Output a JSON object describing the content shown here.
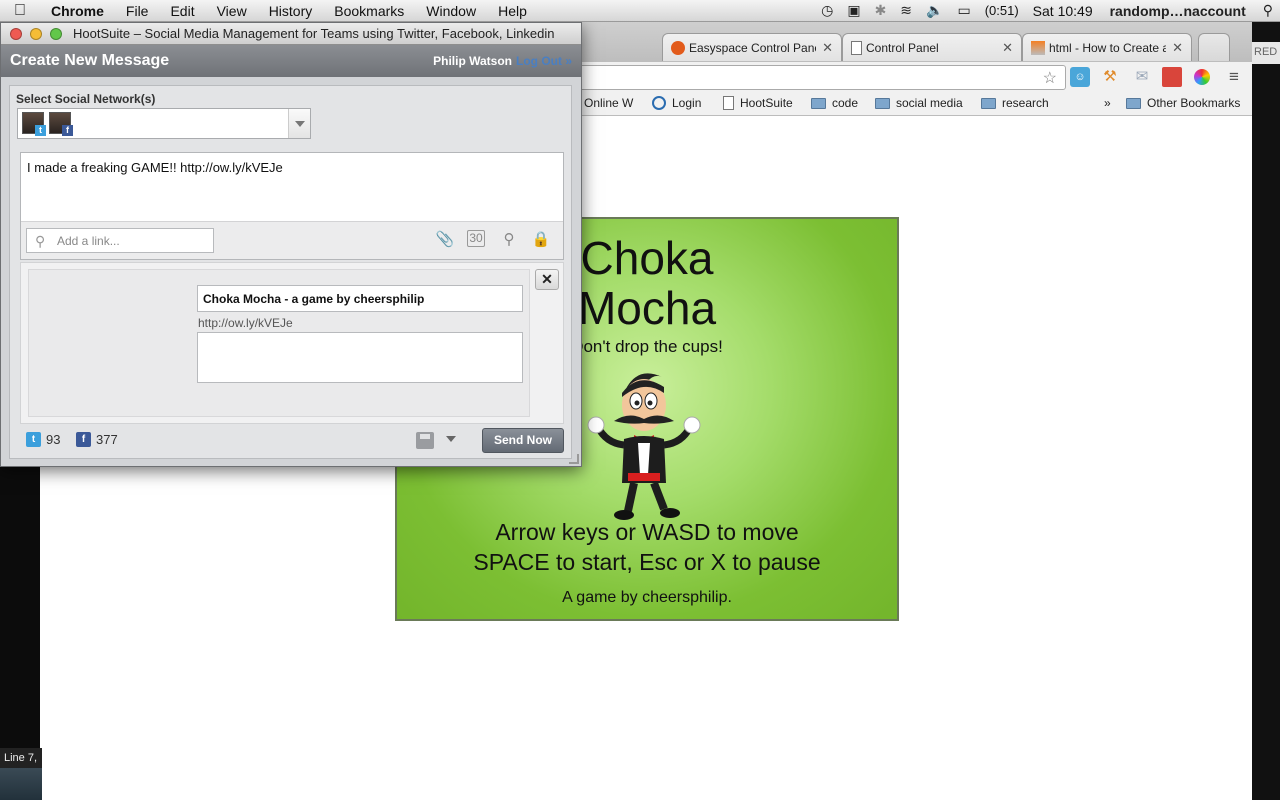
{
  "menubar": {
    "app": "Chrome",
    "menus": [
      "File",
      "Edit",
      "View",
      "History",
      "Bookmarks",
      "Window",
      "Help"
    ],
    "battery": "(0:51)",
    "clock": "Sat 10:49",
    "user": "randomp…naccount"
  },
  "chrome": {
    "tabs": [
      {
        "label": "Easyspace Control Panel"
      },
      {
        "label": "Control Panel"
      },
      {
        "label": "html - How to Create a"
      }
    ],
    "right_tab_edge": "RED",
    "bookmarks": {
      "partial": "Online W",
      "login": "Login",
      "hootsuite": "HootSuite",
      "code": "code",
      "social_media": "social media",
      "research": "research",
      "overflow": "»",
      "other": "Other Bookmarks"
    }
  },
  "game": {
    "title_line1": "Choka",
    "title_line2": "Mocha",
    "subtitle": "Don't drop the cups!",
    "instructions_line1": "Arrow keys or WASD to move",
    "instructions_line2": "SPACE to start, Esc or X to pause",
    "byline": "A game by cheersphilip."
  },
  "status_bar": "Line 7,",
  "hootsuite": {
    "window_title": "HootSuite – Social Media Management for Teams using Twitter, Facebook, Linkedin",
    "header": "Create New Message",
    "user": "Philip Watson",
    "logout": "Log Out »",
    "select_label": "Select Social Network(s)",
    "message": "I made a freaking GAME!! http://ow.ly/kVEJe",
    "add_link_placeholder": "Add a link...",
    "preview": {
      "title": "Choka Mocha - a game by cheersphilip",
      "url": "http://ow.ly/kVEJe",
      "close": "✕"
    },
    "counts": {
      "twitter": "93",
      "facebook": "377"
    },
    "send": "Send Now"
  },
  "colors": {
    "game_green": "#7cbf33",
    "send_button": "#6a717b",
    "twitter": "#3b9fdc",
    "facebook": "#3b5998",
    "logout_link": "#4a7fc2"
  }
}
